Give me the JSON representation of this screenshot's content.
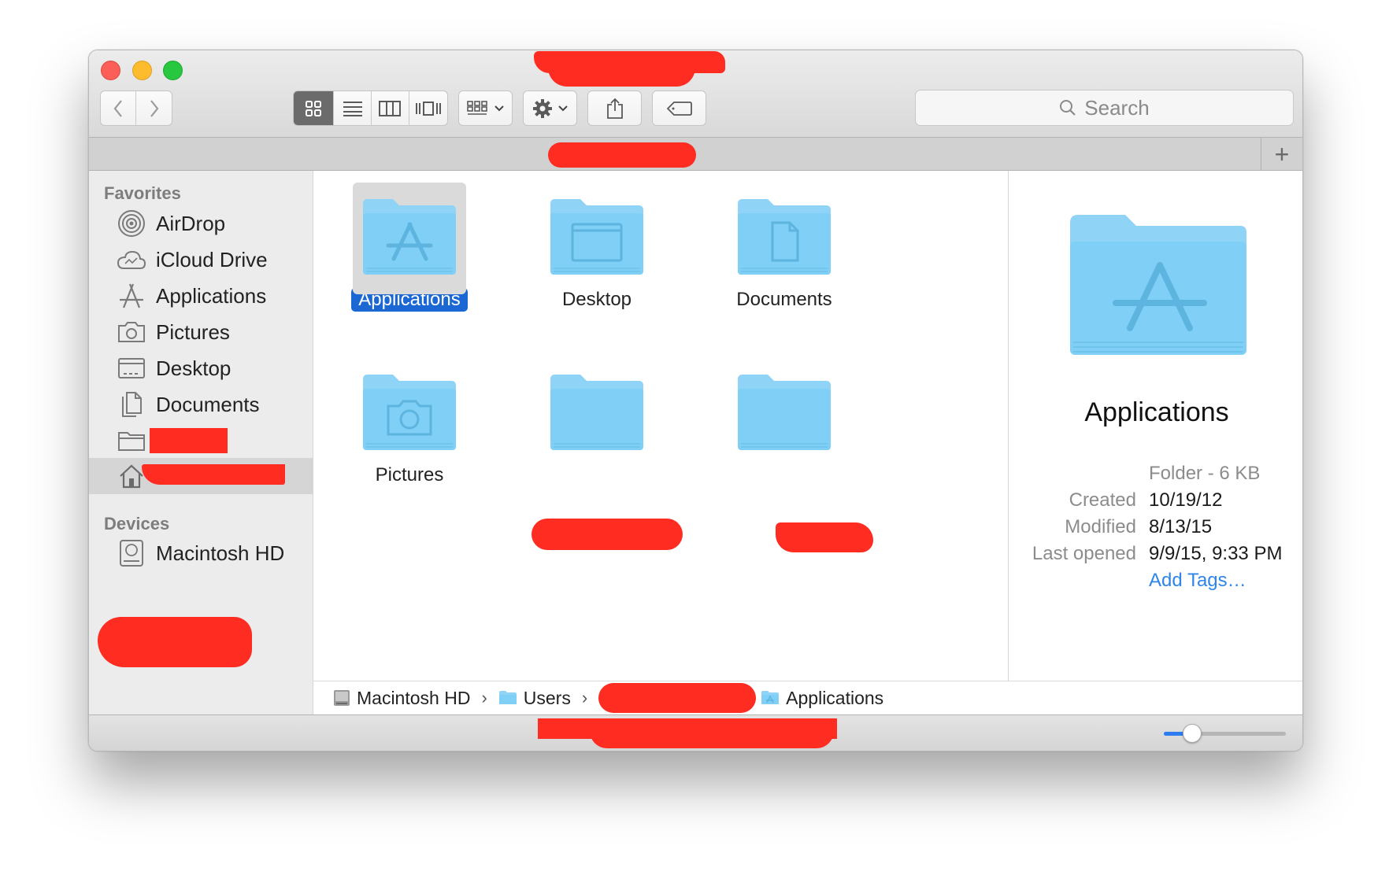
{
  "window": {
    "toolbar": {
      "search_placeholder": "Search"
    },
    "tab_add_label": "+"
  },
  "sidebar": {
    "favorites_header": "Favorites",
    "favorites": [
      {
        "label": "AirDrop",
        "icon": "airdrop-icon"
      },
      {
        "label": "iCloud Drive",
        "icon": "cloud-icon"
      },
      {
        "label": "Applications",
        "icon": "applications-icon"
      },
      {
        "label": "Pictures",
        "icon": "camera-icon"
      },
      {
        "label": "Desktop",
        "icon": "desktop-icon"
      },
      {
        "label": "Documents",
        "icon": "documents-icon"
      }
    ],
    "devices_header": "Devices",
    "devices": [
      {
        "label": "Macintosh HD",
        "icon": "hard-drive-icon"
      }
    ]
  },
  "content": {
    "items": [
      {
        "name": "Applications",
        "icon": "applications-folder-icon",
        "selected": true
      },
      {
        "name": "Desktop",
        "icon": "desktop-folder-icon"
      },
      {
        "name": "Documents",
        "icon": "documents-folder-icon"
      },
      {
        "name": "Pictures",
        "icon": "pictures-folder-icon"
      }
    ]
  },
  "preview": {
    "title": "Applications",
    "kind": "Folder - 6 KB",
    "created_label": "Created",
    "created_value": "10/19/12",
    "modified_label": "Modified",
    "modified_value": "8/13/15",
    "last_opened_label": "Last opened",
    "last_opened_value": "9/9/15, 9:33 PM",
    "add_tags": "Add Tags…"
  },
  "pathbar": {
    "crumbs": [
      "Macintosh HD",
      "Users",
      "Applications"
    ],
    "separator": "›"
  },
  "statusbar": {
    "icon_size_fraction": 0.23
  },
  "colors": {
    "folder_blue": "#7fcff6",
    "selection_blue": "#1b67d3",
    "link_blue": "#2f85ea",
    "redaction_red": "#ff2c22"
  }
}
